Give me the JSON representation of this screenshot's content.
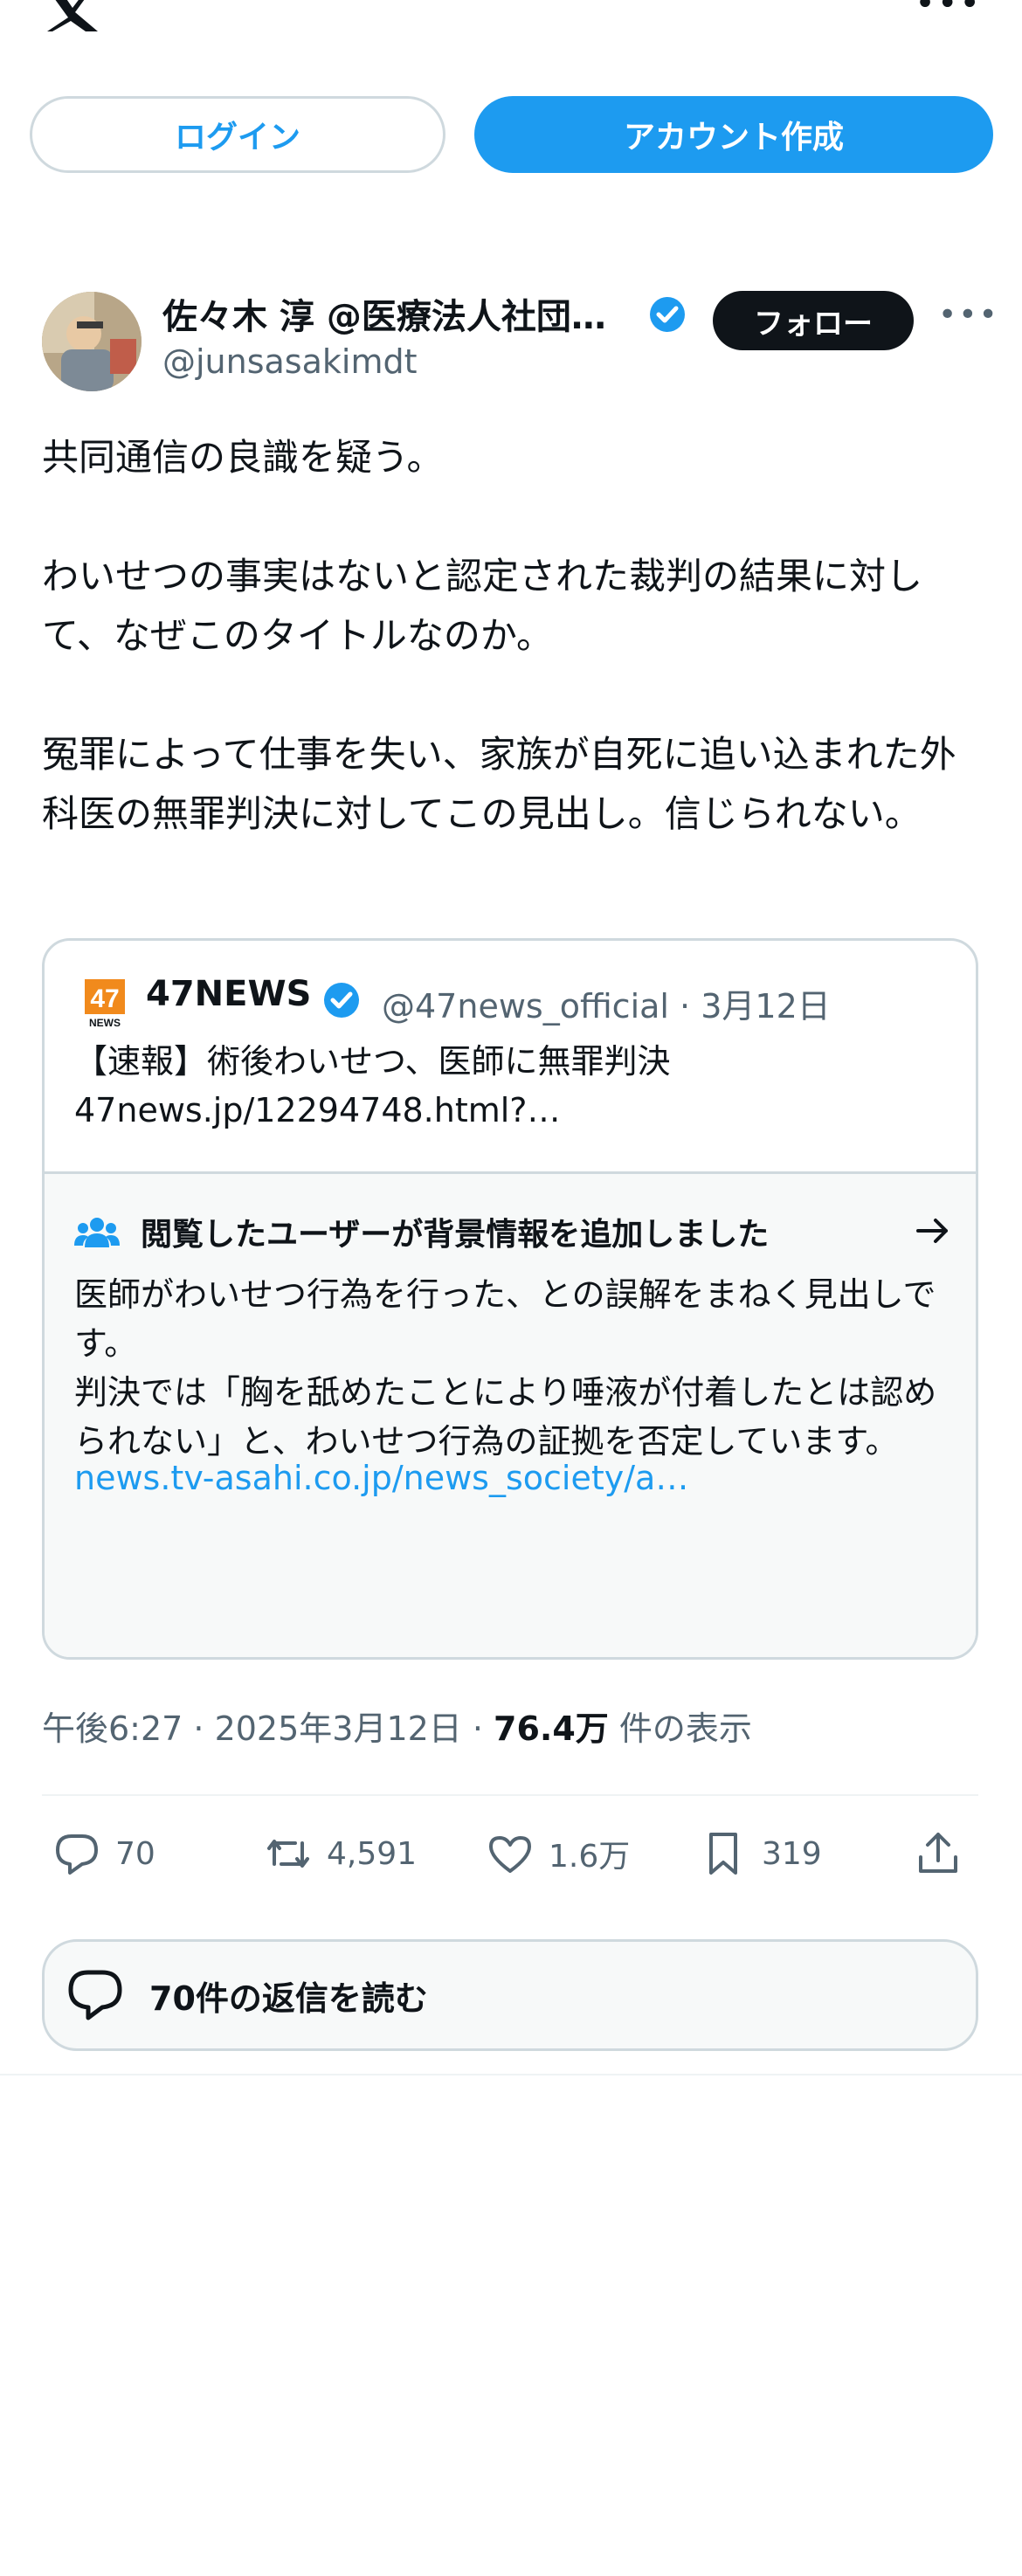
{
  "header": {
    "logo_icon": "x-logo-icon",
    "more_icon": "more-horizontal-icon"
  },
  "auth": {
    "login_label": "ログイン",
    "signup_label": "アカウント作成"
  },
  "tweet": {
    "author_name": "佐々木 淳 @医療法人社団…",
    "handle": "@junsasakimdt",
    "follow_label": "フォロー",
    "text": "共同通信の良識を疑う。\n\nわいせつの事実はないと認定された裁判の結果に対して、なぜこのタイトルなのか。\n\n冤罪によって仕事を失い、家族が自死に追い込まれた外科医の無罪判決に対してこの見出し。信じられない。",
    "quote": {
      "logo_text": "47",
      "logo_sub": "NEWS",
      "name": "47NEWS",
      "meta": "@47news_official · 3月12日",
      "text": "【速報】術後わいせつ、医師に無罪判決\n47news.jp/12294748.html?…",
      "notes_title": "閲覧したユーザーが背景情報を追加しました",
      "notes_body": "医師がわいせつ行為を行った、との誤解をまねく見出しです。\n判決では「胸を舐めたことにより唾液が付着したとは認められない」と、わいせつ行為の証拠を否定しています。",
      "notes_link": "news.tv-asahi.co.jp/news_society/a…"
    },
    "timestamp": "午後6:27 · 2025年3月12日 · ",
    "views_count": "76.4万",
    "views_label": " 件の表示",
    "actions": {
      "replies": "70",
      "retweets": "4,591",
      "likes": "1.6万",
      "bookmarks": "319"
    },
    "read_replies_label": "70件の返信を読む"
  },
  "colors": {
    "accent": "#1d9bf0",
    "text": "#0f1419",
    "muted": "#536471",
    "border": "#cfd9de"
  }
}
